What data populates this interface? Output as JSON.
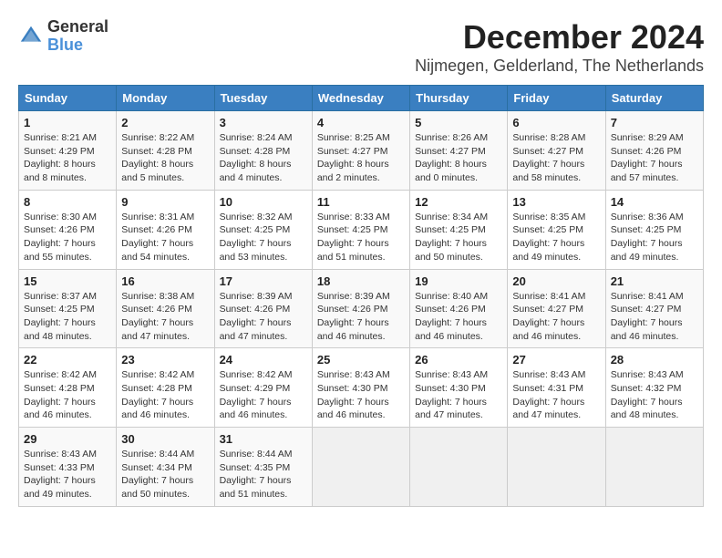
{
  "header": {
    "logo_line1": "General",
    "logo_line2": "Blue",
    "title": "December 2024",
    "subtitle": "Nijmegen, Gelderland, The Netherlands"
  },
  "calendar": {
    "days_of_week": [
      "Sunday",
      "Monday",
      "Tuesday",
      "Wednesday",
      "Thursday",
      "Friday",
      "Saturday"
    ],
    "weeks": [
      [
        {
          "day": 1,
          "info": "Sunrise: 8:21 AM\nSunset: 4:29 PM\nDaylight: 8 hours\nand 8 minutes."
        },
        {
          "day": 2,
          "info": "Sunrise: 8:22 AM\nSunset: 4:28 PM\nDaylight: 8 hours\nand 5 minutes."
        },
        {
          "day": 3,
          "info": "Sunrise: 8:24 AM\nSunset: 4:28 PM\nDaylight: 8 hours\nand 4 minutes."
        },
        {
          "day": 4,
          "info": "Sunrise: 8:25 AM\nSunset: 4:27 PM\nDaylight: 8 hours\nand 2 minutes."
        },
        {
          "day": 5,
          "info": "Sunrise: 8:26 AM\nSunset: 4:27 PM\nDaylight: 8 hours\nand 0 minutes."
        },
        {
          "day": 6,
          "info": "Sunrise: 8:28 AM\nSunset: 4:27 PM\nDaylight: 7 hours\nand 58 minutes."
        },
        {
          "day": 7,
          "info": "Sunrise: 8:29 AM\nSunset: 4:26 PM\nDaylight: 7 hours\nand 57 minutes."
        }
      ],
      [
        {
          "day": 8,
          "info": "Sunrise: 8:30 AM\nSunset: 4:26 PM\nDaylight: 7 hours\nand 55 minutes."
        },
        {
          "day": 9,
          "info": "Sunrise: 8:31 AM\nSunset: 4:26 PM\nDaylight: 7 hours\nand 54 minutes."
        },
        {
          "day": 10,
          "info": "Sunrise: 8:32 AM\nSunset: 4:25 PM\nDaylight: 7 hours\nand 53 minutes."
        },
        {
          "day": 11,
          "info": "Sunrise: 8:33 AM\nSunset: 4:25 PM\nDaylight: 7 hours\nand 51 minutes."
        },
        {
          "day": 12,
          "info": "Sunrise: 8:34 AM\nSunset: 4:25 PM\nDaylight: 7 hours\nand 50 minutes."
        },
        {
          "day": 13,
          "info": "Sunrise: 8:35 AM\nSunset: 4:25 PM\nDaylight: 7 hours\nand 49 minutes."
        },
        {
          "day": 14,
          "info": "Sunrise: 8:36 AM\nSunset: 4:25 PM\nDaylight: 7 hours\nand 49 minutes."
        }
      ],
      [
        {
          "day": 15,
          "info": "Sunrise: 8:37 AM\nSunset: 4:25 PM\nDaylight: 7 hours\nand 48 minutes."
        },
        {
          "day": 16,
          "info": "Sunrise: 8:38 AM\nSunset: 4:26 PM\nDaylight: 7 hours\nand 47 minutes."
        },
        {
          "day": 17,
          "info": "Sunrise: 8:39 AM\nSunset: 4:26 PM\nDaylight: 7 hours\nand 47 minutes."
        },
        {
          "day": 18,
          "info": "Sunrise: 8:39 AM\nSunset: 4:26 PM\nDaylight: 7 hours\nand 46 minutes."
        },
        {
          "day": 19,
          "info": "Sunrise: 8:40 AM\nSunset: 4:26 PM\nDaylight: 7 hours\nand 46 minutes."
        },
        {
          "day": 20,
          "info": "Sunrise: 8:41 AM\nSunset: 4:27 PM\nDaylight: 7 hours\nand 46 minutes."
        },
        {
          "day": 21,
          "info": "Sunrise: 8:41 AM\nSunset: 4:27 PM\nDaylight: 7 hours\nand 46 minutes."
        }
      ],
      [
        {
          "day": 22,
          "info": "Sunrise: 8:42 AM\nSunset: 4:28 PM\nDaylight: 7 hours\nand 46 minutes."
        },
        {
          "day": 23,
          "info": "Sunrise: 8:42 AM\nSunset: 4:28 PM\nDaylight: 7 hours\nand 46 minutes."
        },
        {
          "day": 24,
          "info": "Sunrise: 8:42 AM\nSunset: 4:29 PM\nDaylight: 7 hours\nand 46 minutes."
        },
        {
          "day": 25,
          "info": "Sunrise: 8:43 AM\nSunset: 4:30 PM\nDaylight: 7 hours\nand 46 minutes."
        },
        {
          "day": 26,
          "info": "Sunrise: 8:43 AM\nSunset: 4:30 PM\nDaylight: 7 hours\nand 47 minutes."
        },
        {
          "day": 27,
          "info": "Sunrise: 8:43 AM\nSunset: 4:31 PM\nDaylight: 7 hours\nand 47 minutes."
        },
        {
          "day": 28,
          "info": "Sunrise: 8:43 AM\nSunset: 4:32 PM\nDaylight: 7 hours\nand 48 minutes."
        }
      ],
      [
        {
          "day": 29,
          "info": "Sunrise: 8:43 AM\nSunset: 4:33 PM\nDaylight: 7 hours\nand 49 minutes."
        },
        {
          "day": 30,
          "info": "Sunrise: 8:44 AM\nSunset: 4:34 PM\nDaylight: 7 hours\nand 50 minutes."
        },
        {
          "day": 31,
          "info": "Sunrise: 8:44 AM\nSunset: 4:35 PM\nDaylight: 7 hours\nand 51 minutes."
        },
        null,
        null,
        null,
        null
      ]
    ]
  }
}
